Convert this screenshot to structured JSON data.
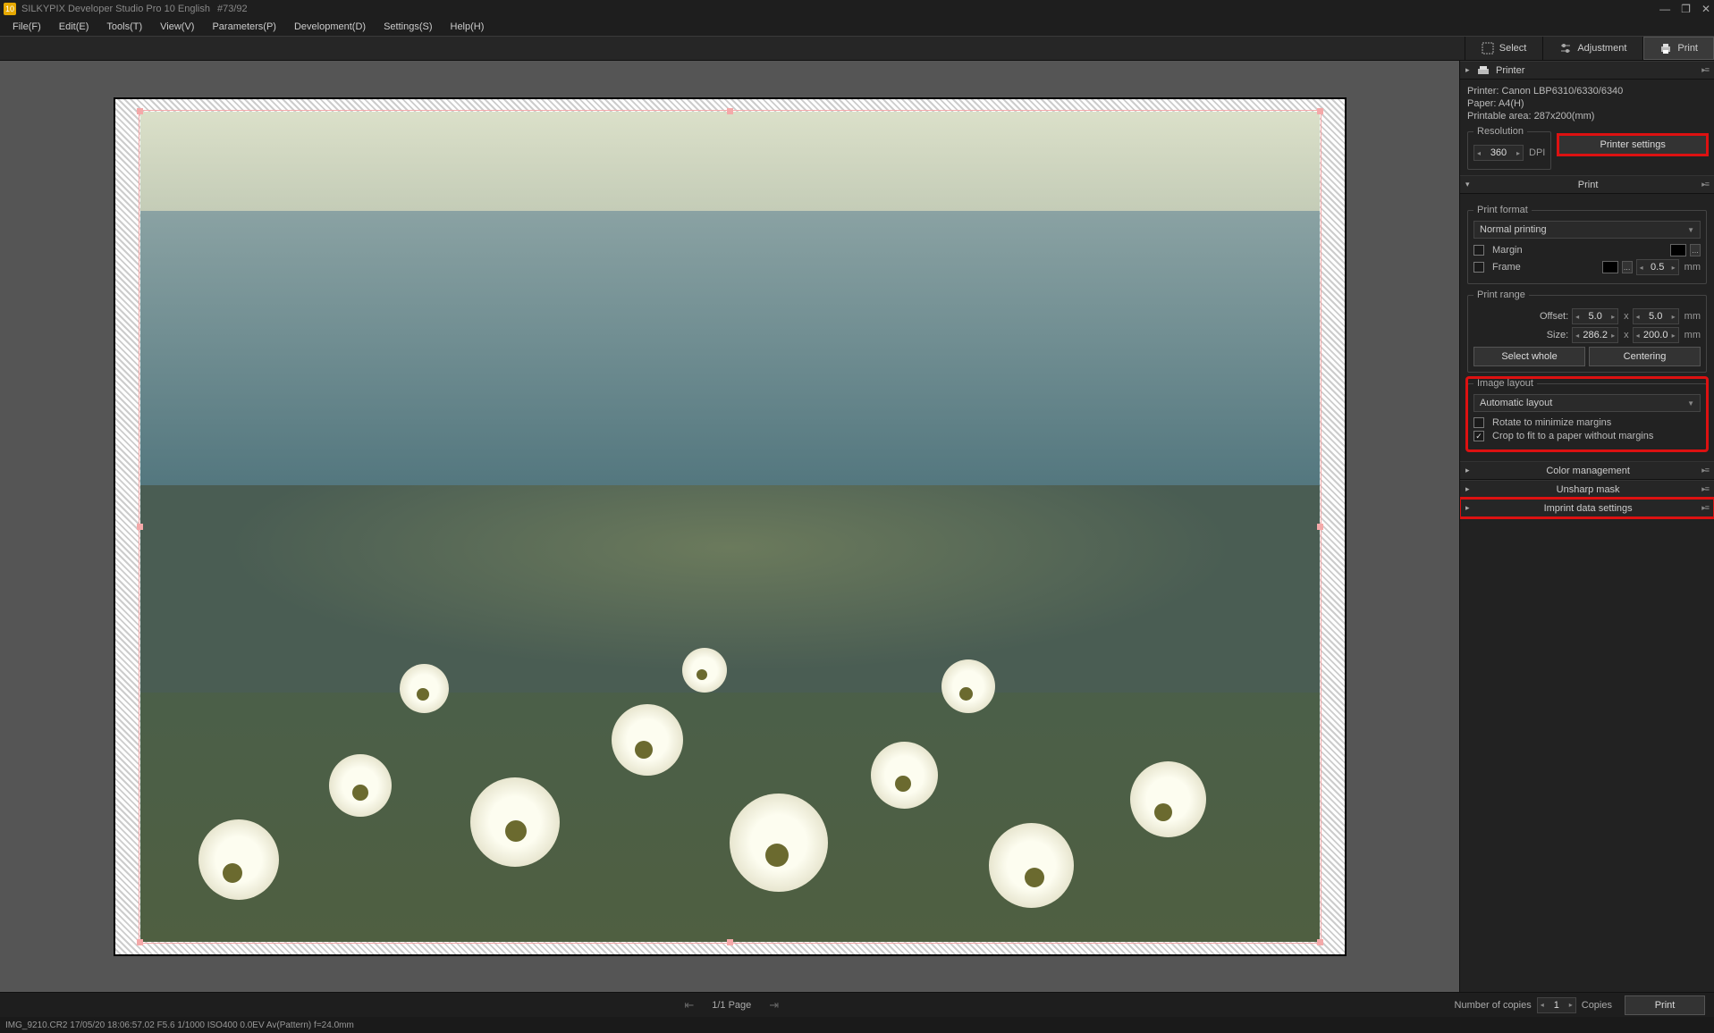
{
  "titlebar": {
    "app_name": "SILKYPIX Developer Studio Pro 10 English",
    "hash": "#73/92"
  },
  "menu": {
    "file": "File(F)",
    "edit": "Edit(E)",
    "tools": "Tools(T)",
    "view": "View(V)",
    "parameters": "Parameters(P)",
    "development": "Development(D)",
    "settings": "Settings(S)",
    "help": "Help(H)"
  },
  "modetabs": {
    "select": "Select",
    "adjustment": "Adjustment",
    "print": "Print"
  },
  "printer": {
    "header": "Printer",
    "name_line": "Printer: Canon LBP6310/6330/6340",
    "paper_line": "Paper: A4(H)",
    "area_line": "Printable area: 287x200(mm)",
    "resolution_legend": "Resolution",
    "resolution_value": "360",
    "resolution_unit": "DPI",
    "settings_btn": "Printer settings"
  },
  "printsec": {
    "header": "Print",
    "format_legend": "Print format",
    "format_mode": "Normal printing",
    "margin_label": "Margin",
    "frame_label": "Frame",
    "frame_value": "0.5",
    "frame_unit": "mm",
    "range_legend": "Print range",
    "offset_label": "Offset:",
    "offset_x": "5.0",
    "offset_dim_x": "x",
    "offset_y": "5.0",
    "offset_unit": "mm",
    "size_label": "Size:",
    "size_w": "286.2",
    "size_dim_x": "x",
    "size_h": "200.0",
    "size_unit": "mm",
    "select_whole": "Select whole",
    "centering": "Centering",
    "layout_legend": "Image layout",
    "layout_mode": "Automatic layout",
    "rotate_label": "Rotate to minimize margins",
    "crop_label": "Crop to fit to a paper without margins"
  },
  "collapse": {
    "color_mgmt": "Color management",
    "unsharp": "Unsharp mask",
    "imprint": "Imprint data settings"
  },
  "pager": {
    "page": "1/1 Page",
    "copies_label": "Number of copies",
    "copies_value": "1",
    "copies_unit": "Copies",
    "print_btn": "Print"
  },
  "status": {
    "text": "IMG_9210.CR2 17/05/20 18:06:57.02 F5.6 1/1000 ISO400  0.0EV Av(Pattern) f=24.0mm"
  }
}
